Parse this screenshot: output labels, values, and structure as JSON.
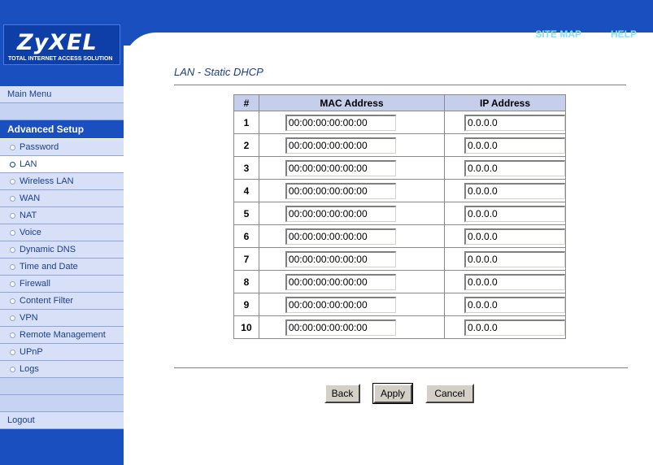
{
  "header": {
    "logo_main": "ZyXEL",
    "logo_sub": "TOTAL INTERNET ACCESS SOLUTION",
    "links": [
      "SITE MAP",
      "HELP"
    ]
  },
  "sidebar": {
    "main_menu": "Main Menu",
    "section": "Advanced Setup",
    "items": [
      {
        "label": "Password",
        "selected": false
      },
      {
        "label": "LAN",
        "selected": true
      },
      {
        "label": "Wireless LAN",
        "selected": false
      },
      {
        "label": "WAN",
        "selected": false
      },
      {
        "label": "NAT",
        "selected": false
      },
      {
        "label": "Voice",
        "selected": false
      },
      {
        "label": "Dynamic DNS",
        "selected": false
      },
      {
        "label": "Time and Date",
        "selected": false
      },
      {
        "label": "Firewall",
        "selected": false
      },
      {
        "label": "Content Filter",
        "selected": false
      },
      {
        "label": "VPN",
        "selected": false
      },
      {
        "label": "Remote Management",
        "selected": false
      },
      {
        "label": "UPnP",
        "selected": false
      },
      {
        "label": "Logs",
        "selected": false
      }
    ],
    "logout": "Logout"
  },
  "page": {
    "title": "LAN - Static DHCP"
  },
  "table": {
    "headers": [
      "#",
      "MAC Address",
      "IP Address"
    ],
    "rows": [
      {
        "num": "1",
        "mac": "00:00:00:00:00:00",
        "ip": "0.0.0.0"
      },
      {
        "num": "2",
        "mac": "00:00:00:00:00:00",
        "ip": "0.0.0.0"
      },
      {
        "num": "3",
        "mac": "00:00:00:00:00:00",
        "ip": "0.0.0.0"
      },
      {
        "num": "4",
        "mac": "00:00:00:00:00:00",
        "ip": "0.0.0.0"
      },
      {
        "num": "5",
        "mac": "00:00:00:00:00:00",
        "ip": "0.0.0.0"
      },
      {
        "num": "6",
        "mac": "00:00:00:00:00:00",
        "ip": "0.0.0.0"
      },
      {
        "num": "7",
        "mac": "00:00:00:00:00:00",
        "ip": "0.0.0.0"
      },
      {
        "num": "8",
        "mac": "00:00:00:00:00:00",
        "ip": "0.0.0.0"
      },
      {
        "num": "9",
        "mac": "00:00:00:00:00:00",
        "ip": "0.0.0.0"
      },
      {
        "num": "10",
        "mac": "00:00:00:00:00:00",
        "ip": "0.0.0.0"
      }
    ]
  },
  "buttons": {
    "back": "Back",
    "apply": "Apply",
    "cancel": "Cancel"
  }
}
